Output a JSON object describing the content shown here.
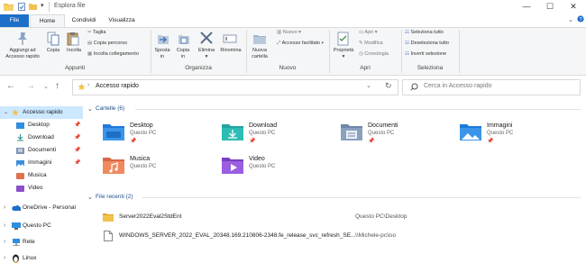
{
  "window": {
    "title": "Esplora file",
    "minimize": "—",
    "maximize": "☐",
    "close": "✕"
  },
  "ribbon_tabs": [
    "File",
    "Home",
    "Condividi",
    "Visualizza"
  ],
  "ribbon": {
    "appunti": {
      "label": "Appunti",
      "pin_quick": "Aggiungi ad\nAccesso rapido",
      "copy": "Copia",
      "paste": "Incolla",
      "cut": "Taglia",
      "copy_path": "Copia percorso",
      "paste_link": "Incolla collegamento"
    },
    "organizza": {
      "label": "Organizza",
      "move_to": "Sposta\nin",
      "copy_to": "Copia\nin",
      "delete": "Elimina",
      "rename": "Rinomina"
    },
    "nuovo": {
      "label": "Nuovo",
      "new_folder": "Nuova\ncartella",
      "new_item": "Nuovo",
      "easy_access": "Accesso facilitato"
    },
    "apri": {
      "label": "Apri",
      "properties": "Proprietà",
      "open": "Apri",
      "edit": "Modifica",
      "history": "Cronologia"
    },
    "seleziona": {
      "label": "Seleziona",
      "select_all": "Seleziona tutto",
      "select_none": "Deseleziona tutto",
      "invert": "Inverti selezione"
    }
  },
  "nav": {
    "address": "Accesso rapido",
    "search_placeholder": "Cerca in Accesso rapido"
  },
  "sidebar": {
    "quick_access": "Accesso rapido",
    "items": [
      {
        "label": "Desktop",
        "icon": "desktop-icon",
        "pinned": true
      },
      {
        "label": "Download",
        "icon": "download-icon",
        "pinned": true
      },
      {
        "label": "Documenti",
        "icon": "documents-icon",
        "pinned": true
      },
      {
        "label": "Immagini",
        "icon": "pictures-icon",
        "pinned": true
      },
      {
        "label": "Musica",
        "icon": "music-icon",
        "pinned": false
      },
      {
        "label": "Video",
        "icon": "video-icon",
        "pinned": false
      }
    ],
    "onedrive": "OneDrive - Personal",
    "this_pc": "Questo PC",
    "network": "Rete",
    "linux": "Linux"
  },
  "folders_section": "Cartelle (6)",
  "folders": [
    {
      "name": "Desktop",
      "location": "Questo PC",
      "pinned": true,
      "icon": "desktop-folder-icon"
    },
    {
      "name": "Download",
      "location": "Questo PC",
      "pinned": true,
      "icon": "download-folder-icon"
    },
    {
      "name": "Documenti",
      "location": "Questo PC",
      "pinned": true,
      "icon": "documents-folder-icon"
    },
    {
      "name": "Immagini",
      "location": "Questo PC",
      "pinned": true,
      "icon": "pictures-folder-icon"
    },
    {
      "name": "Musica",
      "location": "Questo PC",
      "pinned": false,
      "icon": "music-folder-icon"
    },
    {
      "name": "Video",
      "location": "Questo PC",
      "pinned": false,
      "icon": "video-folder-icon"
    }
  ],
  "recent_section": "File recenti (2)",
  "recent": [
    {
      "name": "Server2022Eval2StdEnt",
      "location": "Questo PC\\Desktop",
      "icon": "folder-icon"
    },
    {
      "name": "WINDOWS_SERVER_2022_EVAL_20348.169.210806-2348.fe_release_svc_refresh_SE...",
      "location": "\\\\Michele-pc\\iso",
      "icon": "file-icon"
    }
  ],
  "colors": {
    "accent": "#1e6fc7",
    "sidebar_selected": "#cce8ff",
    "folder_yellow": "#f2c14e"
  }
}
